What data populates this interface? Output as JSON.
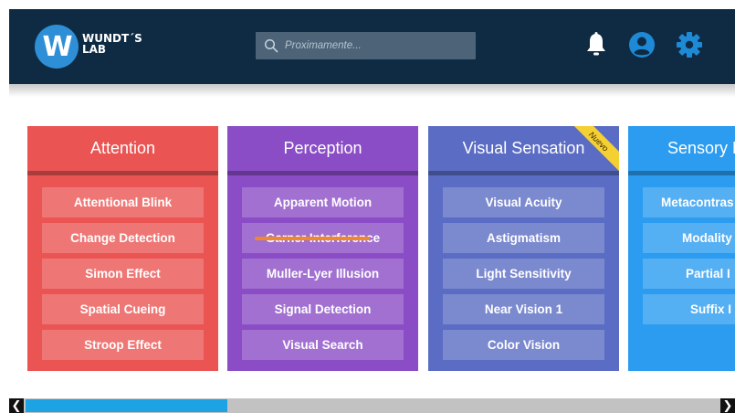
{
  "header": {
    "logo_letter": "W",
    "logo_line1": "WUNDT´S",
    "logo_line2": "LAB",
    "search_placeholder": "Proximamente...",
    "icons": [
      "bell-icon",
      "user-icon",
      "gear-icon"
    ]
  },
  "colors": {
    "header_bg": "#0f2b44",
    "attention": "#ea5553",
    "perception": "#8a4dc6",
    "visual_sensation": "#5b6cc4",
    "sensory_memory": "#2b9cf0",
    "badge": "#f5d033",
    "scroll_thumb": "#1da3e3"
  },
  "categories": [
    {
      "title": "Attention",
      "items": [
        "Attentional Blink",
        "Change Detection",
        "Simon Effect",
        "Spatial Cueing",
        "Stroop Effect"
      ]
    },
    {
      "title": "Perception",
      "items": [
        "Apparent Motion",
        "Garner Interference",
        "Muller-Lyer Illusion",
        "Signal Detection",
        "Visual Search"
      ]
    },
    {
      "title": "Visual Sensation",
      "badge": "Nuevo",
      "items": [
        "Visual Acuity",
        "Astigmatism",
        "Light Sensitivity",
        "Near Vision 1",
        "Color Vision"
      ]
    },
    {
      "title": "Sensory M",
      "items": [
        "Metacontras",
        "Modality",
        "Partial I",
        "Suffix I"
      ]
    }
  ],
  "scrollbar": {
    "left_arrow": "❮",
    "right_arrow": "❯",
    "thumb_fraction": 0.28
  }
}
